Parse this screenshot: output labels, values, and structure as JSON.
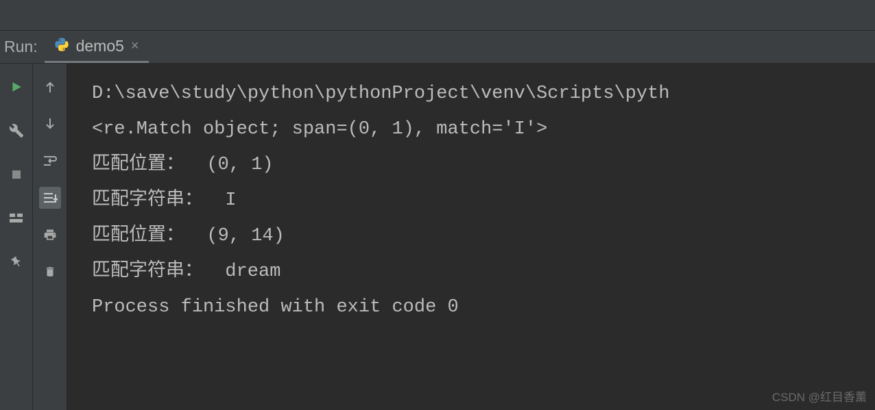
{
  "header": {
    "run_label": "Run:",
    "tab_name": "demo5"
  },
  "console": {
    "lines": [
      "D:\\save\\study\\python\\pythonProject\\venv\\Scripts\\pyth",
      "<re.Match object; span=(0, 1), match='I'>",
      "匹配位置：  (0, 1)",
      "匹配字符串：  I",
      "匹配位置：  (9, 14)",
      "匹配字符串：  dream",
      "",
      "Process finished with exit code 0"
    ]
  },
  "watermark": "CSDN @红目香薰"
}
